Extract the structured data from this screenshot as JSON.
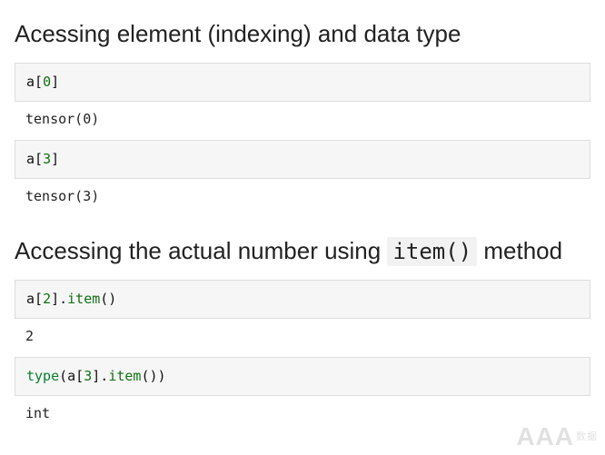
{
  "sections": [
    {
      "heading_plain": "Acessing element (indexing) and data type",
      "heading_html": "Acessing element (indexing) and data type",
      "cells": [
        {
          "code_html": "a[<span class=\"tok-num\">0</span>]",
          "output": "tensor(0)"
        },
        {
          "code_html": "a[<span class=\"tok-num\">3</span>]",
          "output": "tensor(3)"
        }
      ]
    },
    {
      "heading_plain": "Accessing the actual number using item() method",
      "heading_html": "Accessing the actual number using <span class=\"code-inline\">item()</span> method",
      "cells": [
        {
          "code_html": "a[<span class=\"tok-num\">2</span>].<span class=\"tok-call\">item</span>()",
          "output": "2"
        },
        {
          "code_html": "<span class=\"tok-builtin\">type</span>(a[<span class=\"tok-num\">3</span>].<span class=\"tok-call\">item</span>())",
          "output": "int"
        }
      ]
    }
  ],
  "watermark": {
    "main": "AAA",
    "sub": "数据"
  }
}
